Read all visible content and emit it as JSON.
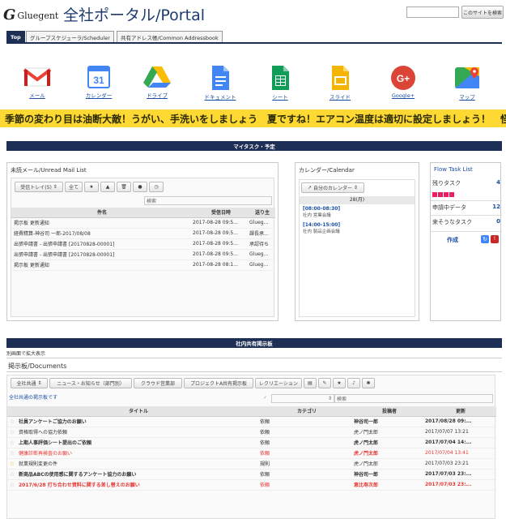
{
  "header": {
    "logo_mark": "G",
    "logo_word": "Gluegent",
    "title": "全社ポータル/Portal",
    "search_placeholder": "",
    "search_button": "このサイトを検索"
  },
  "tabs": [
    {
      "label": "Top"
    },
    {
      "label": "グループスケジューラ/Scheduler"
    },
    {
      "label": "共有アドレス帳/Common Addressbook"
    }
  ],
  "apps": [
    {
      "label": "メール"
    },
    {
      "label": "カレンダー",
      "day": "31"
    },
    {
      "label": "ドライブ"
    },
    {
      "label": "ドキュメント"
    },
    {
      "label": "シート"
    },
    {
      "label": "スライド"
    },
    {
      "label": "Google+",
      "glyph": "G+"
    },
    {
      "label": "マップ"
    }
  ],
  "marquee": "季節の変わり目は油断大敵！うがい、手洗いをしましょう　夏ですね！エアコン温度は適切に設定しましょう！　怪",
  "mytask": {
    "section_title": "マイタスク・予定",
    "mail": {
      "title": "未読メール/Unread Mail List",
      "folder": "受信トレイ(5)",
      "filter_all": "全て",
      "search_placeholder": "検索",
      "headers": [
        "件名",
        "受信日時",
        "送り主"
      ],
      "rows": [
        {
          "subject": "掲示板 更新通知",
          "date": "2017-08-28 09:5...",
          "from": "Glueg..."
        },
        {
          "subject": "経費精算-神谷司 一郎-2017/08/08",
          "date": "2017-08-28 09:5...",
          "from": "課長承..."
        },
        {
          "subject": "出張申請書 - 出張申請書 [20170828-00001]",
          "date": "2017-08-28 09:5...",
          "from": "承認待ち"
        },
        {
          "subject": "出張申請書 - 出張申請書 [20170828-00001]",
          "date": "2017-08-28 09:5...",
          "from": "Glueg..."
        },
        {
          "subject": "掲示板 更新通知",
          "date": "2017-08-28 08:1...",
          "from": "Glueg..."
        }
      ]
    },
    "calendar": {
      "title": "カレンダー/Calendar",
      "my_calendar": "自分のカレンダー",
      "day_header": "28(月)",
      "events": [
        {
          "time": "[08:00-08:30]",
          "desc": "社内 営業会議"
        },
        {
          "time": "[14:00-15:00]",
          "desc": "社内 製品企画会議"
        }
      ]
    },
    "flow": {
      "title": "Flow Task List",
      "items": [
        {
          "label": "残りタスク",
          "count": "4"
        },
        {
          "label": "申請中データ",
          "count": "12"
        },
        {
          "label": "来そうなタスク",
          "count": "0"
        }
      ],
      "create_label": "作成"
    }
  },
  "board": {
    "section_title": "社内共有掲示板",
    "expand_link": "別画面で拡大表示",
    "title": "掲示板/Documents",
    "tabs": [
      "全社共通",
      "ニュース・お知らせ（部門別）",
      "クラウド営業部",
      "プロジェクトA共有掲示板",
      "レクリエーション"
    ],
    "breadcrumb": "全社共通の掲示板です",
    "search_placeholder": "検索",
    "headers": [
      "タイトル",
      "カテゴリ",
      "投稿者",
      "更新"
    ],
    "rows": [
      {
        "title": "社員アンケートご協力のお願い",
        "category": "依頼",
        "author": "神谷司一郎",
        "date": "2017/08/28 09:...",
        "style": "bold",
        "star": false
      },
      {
        "title": "資格取得への協力依頼",
        "category": "依頼",
        "author": "虎ノ門太郎",
        "date": "2017/07/07 13:21",
        "style": "normal",
        "star": false
      },
      {
        "title": "上期人事評価シート提出のご依頼",
        "category": "依頼",
        "author": "虎ノ門太郎",
        "date": "2017/07/04 14:...",
        "style": "bold",
        "star": false
      },
      {
        "title": "健康診断再検査のお願い",
        "category": "依頼",
        "author": "虎ノ門太郎",
        "date": "2017/07/04 13:41",
        "style": "red",
        "star": false
      },
      {
        "title": "就業規則変更の件",
        "category": "規則",
        "author": "虎ノ門太郎",
        "date": "2017/07/03 23:21",
        "style": "normal",
        "star": true
      },
      {
        "title": "新商品ABCの使用感に関するアンケート協力のお願い",
        "category": "依頼",
        "author": "神谷司一郎",
        "date": "2017/07/03 23:...",
        "style": "bold",
        "star": false
      },
      {
        "title": "2017/6/28 打ち合わせ資料に関する差し替えのお願い",
        "category": "依頼",
        "author": "恵比寿次郎",
        "date": "2017/07/03 23:...",
        "style": "redbold",
        "star": false
      }
    ]
  }
}
